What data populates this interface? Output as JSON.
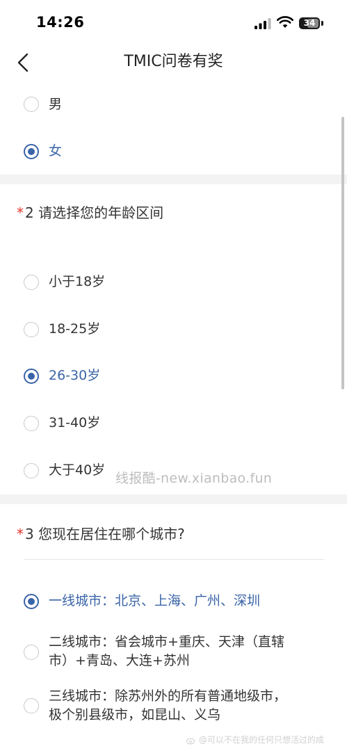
{
  "status_bar": {
    "time": "14:26",
    "battery": "34"
  },
  "nav": {
    "title": "TMIC问卷有奖"
  },
  "q1": {
    "options": [
      {
        "label": "男",
        "checked": false
      },
      {
        "label": "女",
        "checked": true
      }
    ]
  },
  "q2": {
    "required_mark": "*",
    "title": "2 请选择您的年龄区间",
    "options": [
      {
        "label": "小于18岁",
        "checked": false
      },
      {
        "label": "18-25岁",
        "checked": false
      },
      {
        "label": "26-30岁",
        "checked": true
      },
      {
        "label": "31-40岁",
        "checked": false
      },
      {
        "label": "大于40岁",
        "checked": false
      }
    ]
  },
  "q3": {
    "required_mark": "*",
    "title": "3 您现在居住在哪个城市?",
    "options": [
      {
        "label": "一线城市：北京、上海、广州、深圳",
        "checked": true
      },
      {
        "label": "二线城市：省会城市+重庆、天津（直辖\n市）+青岛、大连+苏州",
        "checked": false
      },
      {
        "label": "三线城市：除苏州外的所有普通地级市，\n极个别县级市，如昆山、义乌",
        "checked": false
      }
    ]
  },
  "watermark": "线报酷-new.xianbao.fun",
  "weibo_watermark": "@可以不在我的任何只想活过的成",
  "colors": {
    "accent": "#3a64a8",
    "required": "#e0342b",
    "section_gap": "#f3f3f3"
  }
}
